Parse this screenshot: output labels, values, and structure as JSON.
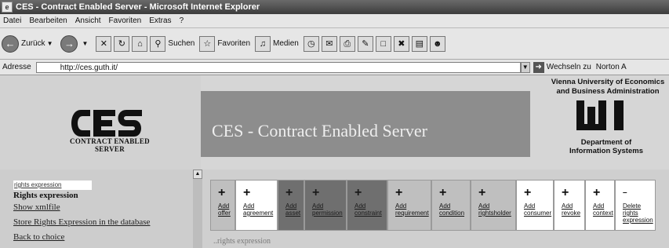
{
  "window": {
    "title": "CES - Contract Enabled Server - Microsoft Internet Explorer"
  },
  "menu": [
    "Datei",
    "Bearbeiten",
    "Ansicht",
    "Favoriten",
    "Extras",
    "?"
  ],
  "toolbar": {
    "back": "Zurück",
    "search": "Suchen",
    "favorites": "Favoriten",
    "media": "Medien"
  },
  "address": {
    "label": "Adresse",
    "url": "http://ces.guth.it/",
    "go": "Wechseln zu",
    "links": "Norton A"
  },
  "logo": {
    "line1": "CONTRACT ENABLED",
    "line2": "SERVER"
  },
  "banner": {
    "title": "CES - Contract Enabled Server"
  },
  "university": {
    "name_line1": "Vienna University of Economics",
    "name_line2": "and Business Administration",
    "dept_line1": "Department of",
    "dept_line2": "Information Systems"
  },
  "sidebar": {
    "field_value": "rights expression",
    "heading": "Rights expression",
    "links": [
      "Show xmlfile",
      "Store Rights Expression in the database",
      "Back to choice"
    ]
  },
  "actions": [
    {
      "l1": "Add",
      "l2": "offer",
      "style": "grey"
    },
    {
      "l1": "Add",
      "l2": "agreement",
      "style": "white"
    },
    {
      "l1": "Add",
      "l2": "asset",
      "style": "dark"
    },
    {
      "l1": "Add",
      "l2": "permission",
      "style": "dark"
    },
    {
      "l1": "Add",
      "l2": "constraint",
      "style": "dark"
    },
    {
      "l1": "Add",
      "l2": "requirement",
      "style": "grey"
    },
    {
      "l1": "Add",
      "l2": "condition",
      "style": "grey"
    },
    {
      "l1": "Add",
      "l2": "rightsholder",
      "style": "grey"
    },
    {
      "l1": "Add",
      "l2": "consumer",
      "style": "white"
    },
    {
      "l1": "Add",
      "l2": "revoke",
      "style": "white"
    },
    {
      "l1": "Add",
      "l2": "context",
      "style": "white"
    },
    {
      "l1": "Delete",
      "l2": "rights",
      "l3": "expression",
      "style": "white"
    }
  ],
  "content": {
    "partial_text": "..rights expression"
  }
}
